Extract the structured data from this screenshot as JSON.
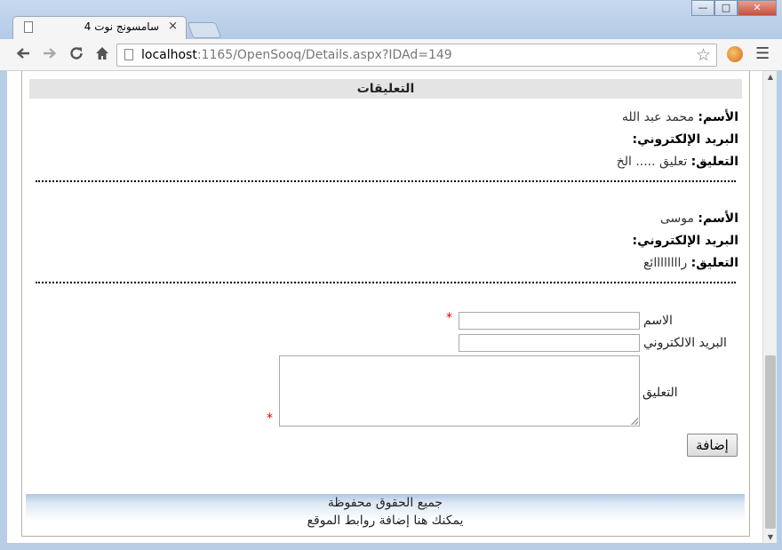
{
  "browser": {
    "tab_title": "سامسونج نوت 4",
    "tab_close": "×",
    "url_host": "localhost",
    "url_rest": ":1165/OpenSooq/Details.aspx?IDAd=149",
    "window_controls": {
      "minimize": "—",
      "maximize": "□",
      "close": "✕"
    },
    "icons": {
      "back": "back-arrow-icon",
      "forward": "forward-arrow-icon",
      "reload": "reload-icon",
      "home": "home-icon",
      "bookmark": "star-icon",
      "menu": "hamburger-menu-icon"
    }
  },
  "page": {
    "comments_title": "التعليقات",
    "field_labels": {
      "name": "الأسم:",
      "email": "البريد الإلكتروني:",
      "comment": "التعليق:"
    },
    "comments": [
      {
        "name": "محمد عبد الله",
        "email": "",
        "comment": "تعليق ..... الخ"
      },
      {
        "name": "موسى",
        "email": "",
        "comment": "راااااااائع"
      }
    ],
    "form": {
      "name_label": "الاسم",
      "email_label": "البريد الالكتروني",
      "comment_label": "التعليق",
      "name_value": "",
      "email_value": "",
      "comment_value": "",
      "required_mark": "*",
      "submit_label": "إضافة"
    },
    "footer": {
      "line1": "جميع الحقوق محفوظة",
      "line2": "يمكنك هنا إضافة روابط الموقع"
    }
  },
  "colors": {
    "required": "#e00000",
    "header_bg": "#e4e4e4"
  }
}
